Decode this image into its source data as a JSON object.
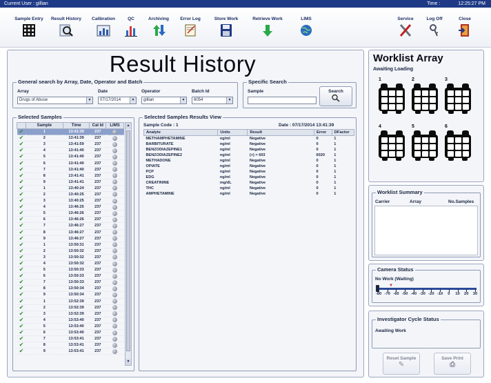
{
  "titlebar": {
    "user": "Current User : gillian",
    "time_label": "Time :",
    "time": "12:25:27 PM"
  },
  "toolbar": [
    {
      "label": "Sample Entry",
      "icon": "grid-icon"
    },
    {
      "label": "Result History",
      "icon": "magnifier-icon"
    },
    {
      "label": "Calibration",
      "icon": "calibration-icon"
    },
    {
      "label": "QC",
      "icon": "bar-chart-icon"
    },
    {
      "label": "Archiving",
      "icon": "archive-arrows-icon"
    },
    {
      "label": "Error Log",
      "icon": "error-log-icon"
    },
    {
      "label": "Store Work",
      "icon": "floppy-icon"
    },
    {
      "label": "Retrieve Work",
      "icon": "retrieve-arrow-icon"
    },
    {
      "label": "LIMS",
      "icon": "globe-icon"
    },
    {
      "label": "Service",
      "icon": "tools-icon"
    },
    {
      "label": "Log Off",
      "icon": "key-icon"
    },
    {
      "label": "Close",
      "icon": "exit-door-icon"
    }
  ],
  "page_title": "Result History",
  "general_search": {
    "title": "General search by Array, Date, Operator and Batch",
    "array_label": "Array",
    "array_value": "Drugs of Abuse",
    "date_label": "Date",
    "date_value": "07/17/2014",
    "operator_label": "Operator",
    "operator_value": "gillian",
    "batch_label": "Batch Id",
    "batch_value": "6054"
  },
  "specific_search": {
    "title": "Specific Search",
    "sample_label": "Sample",
    "sample_value": "",
    "search_button": "Search"
  },
  "selected_samples": {
    "title": "Selected Samples",
    "columns": [
      "Sample",
      "Time",
      "Cal Id",
      "LIMS"
    ],
    "rows": [
      [
        "1",
        "13:41:39",
        "237",
        "(-)"
      ],
      [
        "2",
        "13:41:39",
        "237",
        ""
      ],
      [
        "3",
        "13:41:59",
        "237",
        ""
      ],
      [
        "4",
        "13:41:40",
        "237",
        ""
      ],
      [
        "5",
        "13:41:40",
        "237",
        ""
      ],
      [
        "6",
        "13:41:40",
        "237",
        ""
      ],
      [
        "7",
        "13:41:40",
        "237",
        ""
      ],
      [
        "8",
        "13:41:41",
        "237",
        ""
      ],
      [
        "9",
        "13:41:41",
        "237",
        ""
      ],
      [
        "1",
        "13:40:24",
        "237",
        ""
      ],
      [
        "2",
        "13:40:25",
        "237",
        ""
      ],
      [
        "3",
        "13:40:25",
        "237",
        ""
      ],
      [
        "4",
        "13:46:25",
        "237",
        ""
      ],
      [
        "5",
        "13:46:26",
        "237",
        ""
      ],
      [
        "6",
        "13:46:26",
        "237",
        ""
      ],
      [
        "7",
        "13:46:27",
        "237",
        ""
      ],
      [
        "8",
        "13:46:27",
        "237",
        ""
      ],
      [
        "9",
        "13:46:27",
        "237",
        ""
      ],
      [
        "1",
        "13:50:31",
        "237",
        ""
      ],
      [
        "2",
        "13:50:32",
        "237",
        ""
      ],
      [
        "3",
        "13:50:32",
        "237",
        ""
      ],
      [
        "4",
        "13:50:32",
        "237",
        ""
      ],
      [
        "5",
        "13:50:33",
        "237",
        ""
      ],
      [
        "6",
        "13:50:33",
        "237",
        ""
      ],
      [
        "7",
        "13:50:33",
        "237",
        ""
      ],
      [
        "8",
        "13:50:34",
        "237",
        ""
      ],
      [
        "9",
        "13:50:34",
        "237",
        ""
      ],
      [
        "1",
        "13:52:39",
        "237",
        ""
      ],
      [
        "2",
        "13:52:39",
        "237",
        ""
      ],
      [
        "3",
        "13:52:39",
        "237",
        ""
      ],
      [
        "4",
        "13:53:40",
        "237",
        ""
      ],
      [
        "5",
        "13:53:40",
        "237",
        ""
      ],
      [
        "6",
        "13:53:40",
        "237",
        ""
      ],
      [
        "7",
        "13:53:41",
        "237",
        ""
      ],
      [
        "8",
        "13:53:41",
        "237",
        ""
      ],
      [
        "9",
        "13:53:41",
        "237",
        ""
      ]
    ]
  },
  "results_view": {
    "title": "Selected Samples Results View",
    "sample_code": "Sample Code : 1",
    "date": "Date : 07/17/2014 13:41:39",
    "columns": [
      "Analyte",
      "Units",
      "Result",
      "Error",
      "DFactor"
    ],
    "rows": [
      [
        "METHAMPHETAMINE",
        "ng/ml",
        "Negative",
        "0",
        "1"
      ],
      [
        "BARBITURATE",
        "ng/ml",
        "Negative",
        "0",
        "1"
      ],
      [
        "BENZODIAZEPINE1",
        "ng/ml",
        "Negative",
        "0",
        "1"
      ],
      [
        "BENZODIAZEPINE2",
        "ng/ml",
        "(+) > 603",
        "6020",
        "1"
      ],
      [
        "METHADONE",
        "ng/ml",
        "Negative",
        "0",
        "1"
      ],
      [
        "OPIATE",
        "ng/ml",
        "Negative",
        "0",
        "1"
      ],
      [
        "PCP",
        "ng/ml",
        "Negative",
        "0",
        "1"
      ],
      [
        "EDG",
        "ng/ml",
        "Negative",
        "0",
        "1"
      ],
      [
        "CREATININE",
        "mg/dL",
        "Negative",
        "0",
        "1"
      ],
      [
        "THC",
        "ng/ml",
        "Negative",
        "0",
        "1"
      ],
      [
        "AMPHETAMINE",
        "ng/ml",
        "Negative",
        "0",
        "1"
      ]
    ]
  },
  "worklist": {
    "title": "Worklist Array",
    "status": "Awaiting Loading",
    "trays": [
      "1",
      "2",
      "3",
      "4",
      "5",
      "6"
    ]
  },
  "worklist_summary": {
    "title": "Worklist Summary",
    "columns": [
      "Carrier",
      "Array",
      "No.Samples"
    ]
  },
  "camera": {
    "title": "Camera Status",
    "status": "No Work (Waiting)",
    "ticks": [
      "-80",
      "-70",
      "-60",
      "-50",
      "-40",
      "-30",
      "-20",
      "-10",
      "0",
      "10",
      "20",
      "30"
    ]
  },
  "investigator": {
    "title": "Investigator Cycle Status",
    "status": "Awaiting Work"
  },
  "bottom_buttons": {
    "left": "Reset Sample",
    "right": "Save Print"
  },
  "colors": {
    "titlebar": "#1e3a86",
    "selected_row": "#8b9fcb",
    "check": "#2a8a2a"
  }
}
